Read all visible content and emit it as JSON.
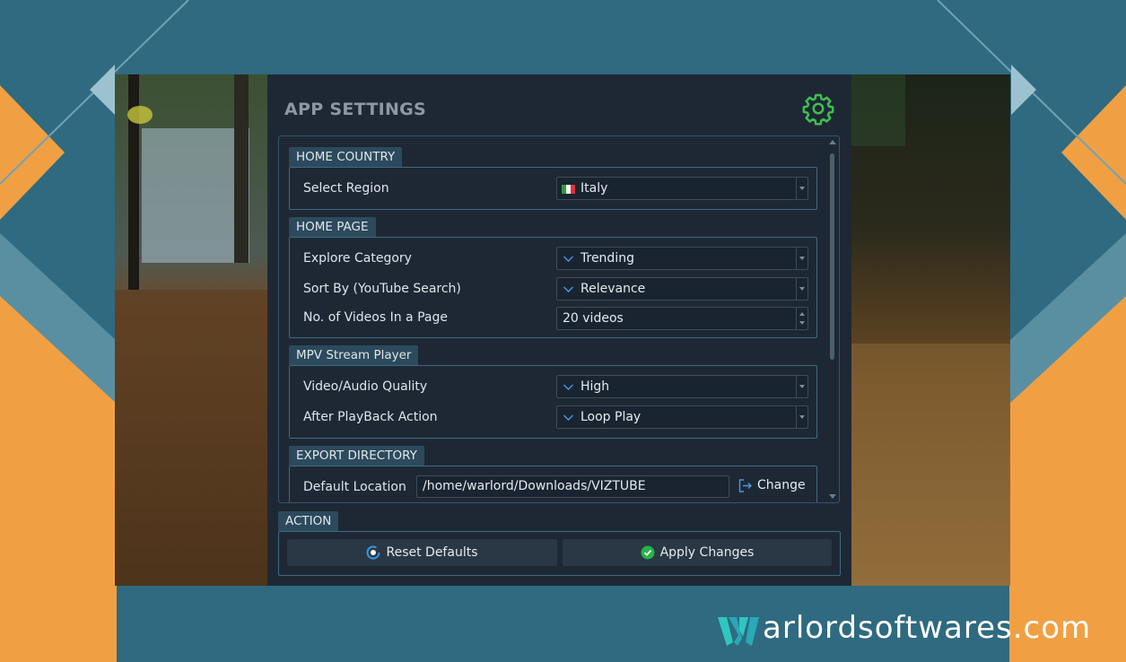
{
  "window": {
    "title": "APP SETTINGS",
    "settings_icon": "gear-icon"
  },
  "sections": {
    "home_country": {
      "header": "HOME COUNTRY",
      "select_region_label": "Select Region",
      "select_region_value": "Italy"
    },
    "home_page": {
      "header": "HOME PAGE",
      "explore_category_label": "Explore Category",
      "explore_category_value": "Trending",
      "sort_by_label": "Sort By (YouTube Search)",
      "sort_by_value": "Relevance",
      "videos_per_page_label": "No. of Videos In a Page",
      "videos_per_page_value": "20 videos"
    },
    "mpv_player": {
      "header": "MPV Stream Player",
      "quality_label": "Video/Audio Quality",
      "quality_value": "High",
      "after_playback_label": "After PlayBack Action",
      "after_playback_value": "Loop Play"
    },
    "export_directory": {
      "header": "EXPORT DIRECTORY",
      "default_location_label": "Default Location",
      "default_location_value": "/home/warlord/Downloads/VIZTUBE",
      "change_label": "Change"
    }
  },
  "action": {
    "header": "ACTION",
    "reset_label": "Reset Defaults",
    "apply_label": "Apply Changes"
  },
  "watermark": {
    "logo_letter": "W",
    "text": "arlordsoftwares.com"
  },
  "colors": {
    "background": "#2f6a80",
    "accent_orange": "#f0a043",
    "panel": "#1e2835",
    "section_tab": "#2c4a5c",
    "gear_green": "#3fbf4f",
    "apply_green": "#27b24a",
    "reset_blue": "#3a8fd6"
  }
}
